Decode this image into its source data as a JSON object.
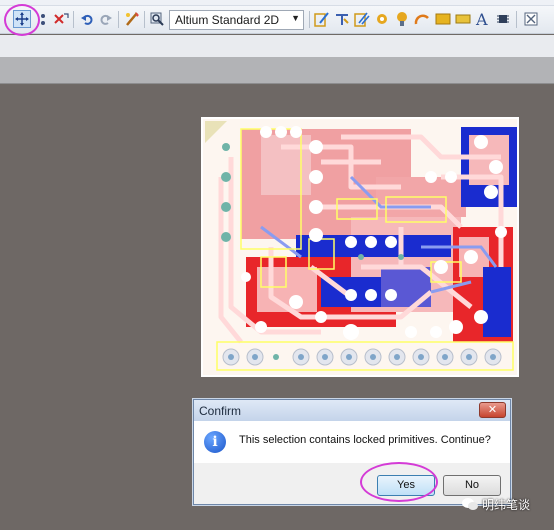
{
  "toolbar": {
    "layer_select": "Altium Standard 2D",
    "icons": [
      "move-icon",
      "cross-select-icon",
      "cross-clear-icon",
      "undo-icon",
      "redo-icon",
      "route-icon",
      "zoom-icon",
      "interactive-route-icon",
      "diff-pair-icon",
      "multi-route-icon",
      "via-icon",
      "pad-icon",
      "arc-icon",
      "fill-icon",
      "solid-region-icon",
      "string-icon",
      "component-icon",
      "cross-probe-icon"
    ]
  },
  "dialog": {
    "title": "Confirm",
    "close_label": "✕",
    "icon": "info-icon",
    "message": "This selection contains locked primitives. Continue?",
    "yes_label": "Yes",
    "no_label": "No"
  },
  "watermark": {
    "text": "明纬笔谈",
    "icon": "wechat-icon"
  },
  "colors": {
    "top_layer": "#e8262a",
    "bottom_layer": "#1a2ccf",
    "overlay": "#ffd9d9",
    "silkscreen": "#ffff66",
    "highlight_ring": "#d43bd6"
  }
}
